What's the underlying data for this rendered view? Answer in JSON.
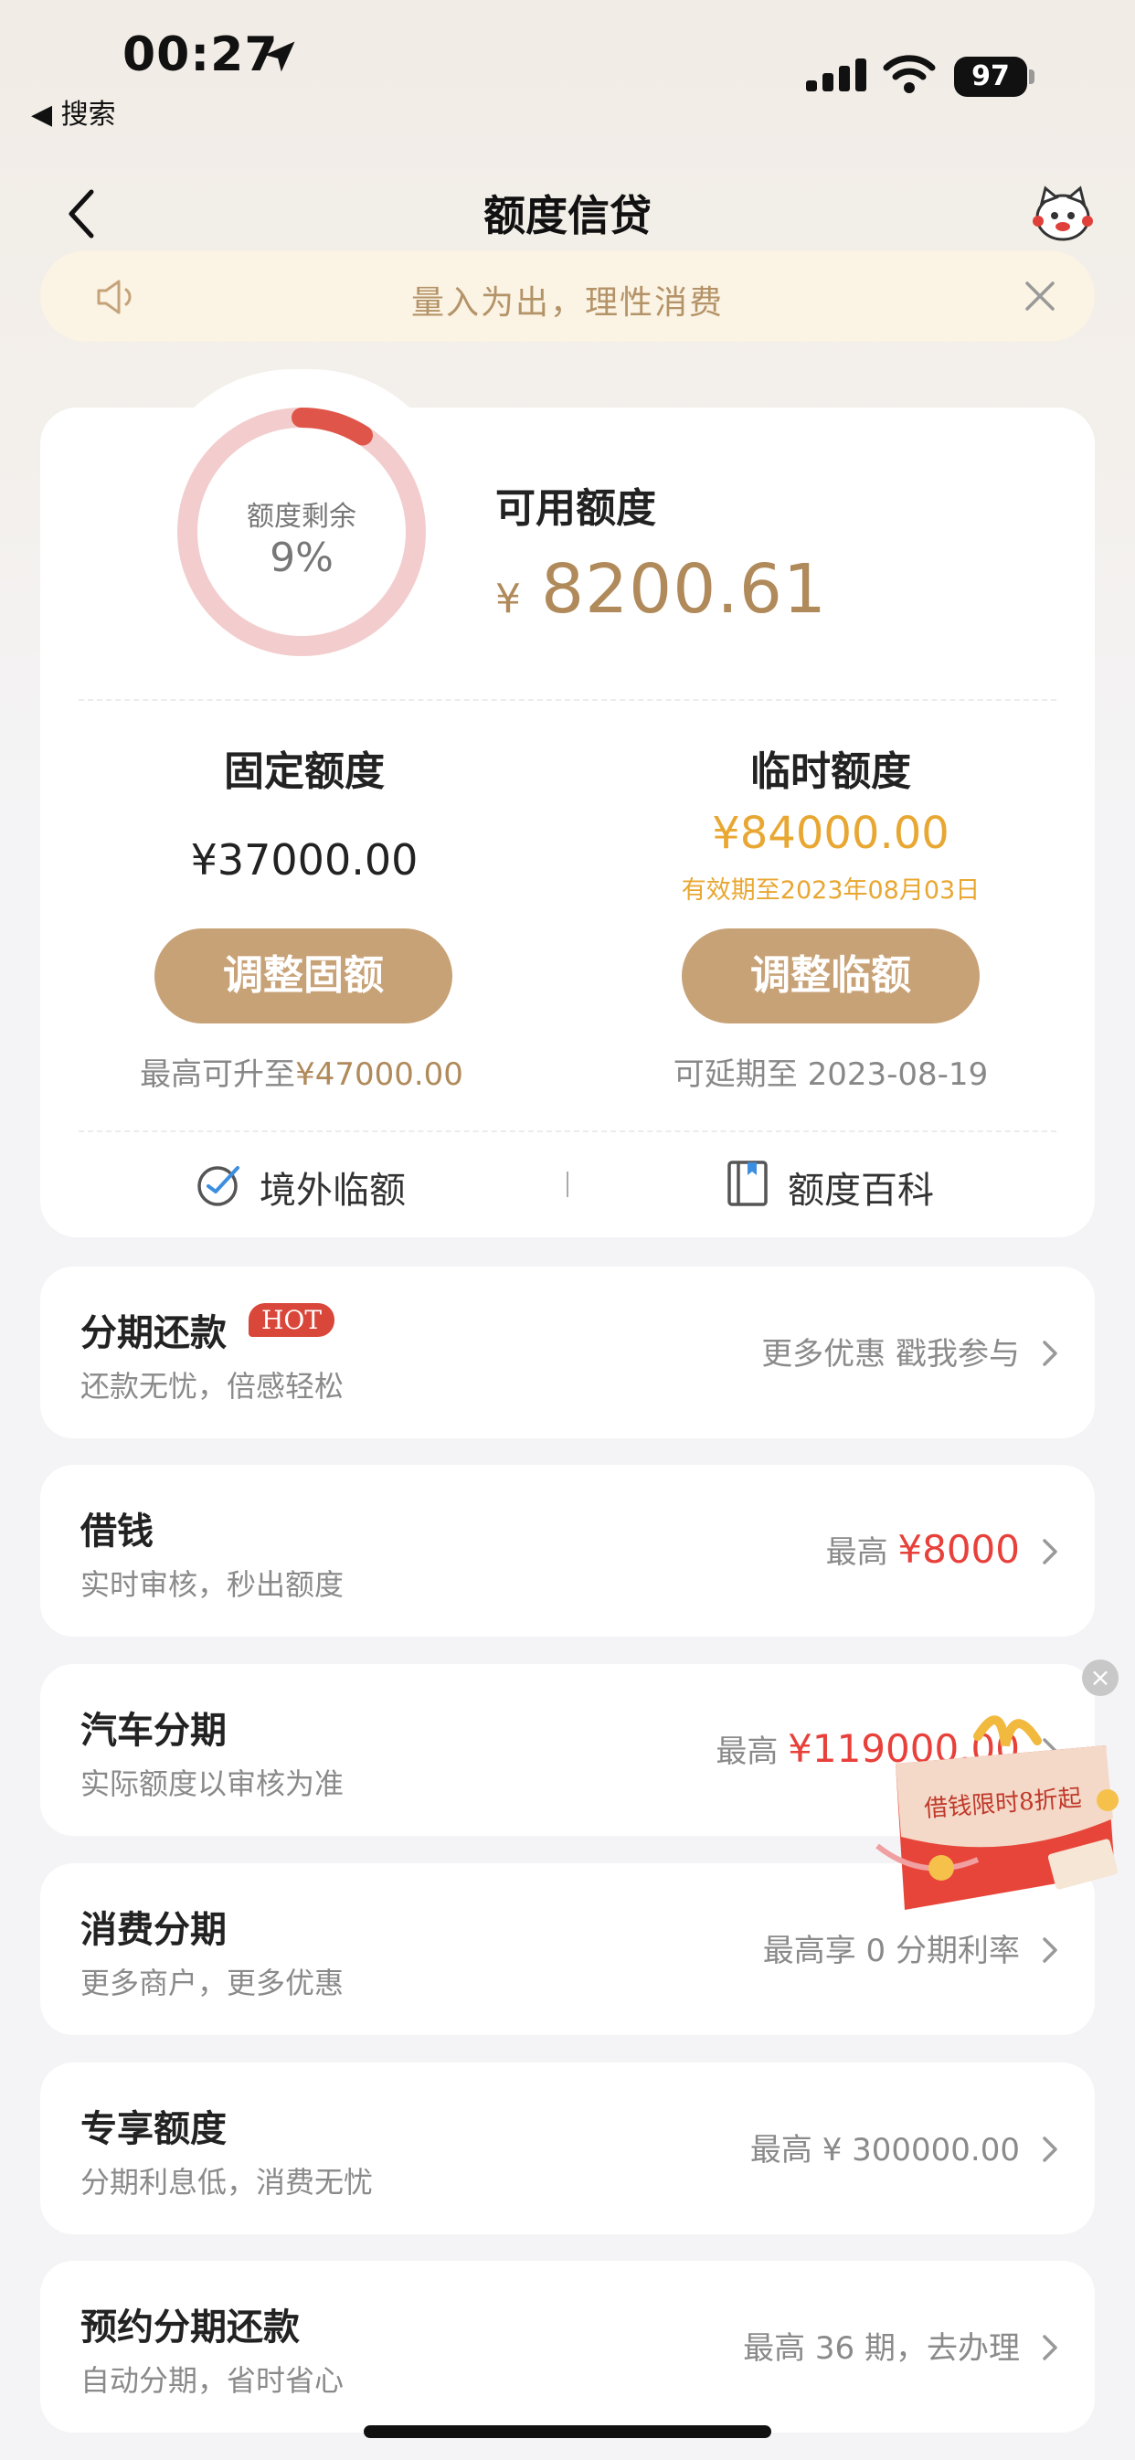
{
  "status_bar": {
    "time": "00:27",
    "back_app": "◀ 搜索",
    "battery": "97"
  },
  "nav": {
    "title": "额度信贷"
  },
  "notice": {
    "text": "量入为出，理性消费"
  },
  "quota": {
    "remaining_label": "额度剩余",
    "remaining_percent": "9%",
    "remaining_fraction": 0.09,
    "available_label": "可用额度",
    "currency": "¥",
    "available_amount": "8200.61",
    "fixed": {
      "title": "固定额度",
      "amount": "¥37000.00",
      "button": "调整固额",
      "note_prefix": "最高可升至",
      "note_value": "¥47000.00"
    },
    "temporary": {
      "title": "临时额度",
      "amount": "¥84000.00",
      "validity": "有效期至2023年08月03日",
      "button": "调整临额",
      "note": "可延期至 2023-08-19"
    },
    "links": {
      "overseas": "境外临额",
      "wiki": "额度百科"
    }
  },
  "colors": {
    "accent": "#c8a277",
    "gold": "#b08a5a",
    "orange": "#e8a732",
    "red": "#e8403a",
    "ring_track": "#f3cdcd",
    "ring_fill": "#e0554a"
  },
  "items": [
    {
      "title": "分期还款",
      "badge": "HOT",
      "subtitle": "还款无忧，倍感轻松",
      "right_text": "更多优惠 戳我参与",
      "right_value": ""
    },
    {
      "title": "借钱",
      "subtitle": "实时审核，秒出额度",
      "right_text": "最高 ",
      "right_value": "¥8000"
    },
    {
      "title": "汽车分期",
      "subtitle": "实际额度以审核为准",
      "right_text": "最高 ",
      "right_value": "¥119000.00"
    },
    {
      "title": "消费分期",
      "subtitle": "更多商户，更多优惠",
      "right_text": "最高享 0 分期利率",
      "right_value": ""
    },
    {
      "title": "专享额度",
      "subtitle": "分期利息低，消费无忧",
      "right_text": "最高 ¥ 300000.00",
      "right_value": ""
    },
    {
      "title": "预约分期还款",
      "subtitle": "自动分期，省时省心",
      "right_text": "最高 36 期，去办理",
      "right_value": ""
    }
  ],
  "ad": {
    "text": "借钱限时8折起",
    "close": "×"
  }
}
